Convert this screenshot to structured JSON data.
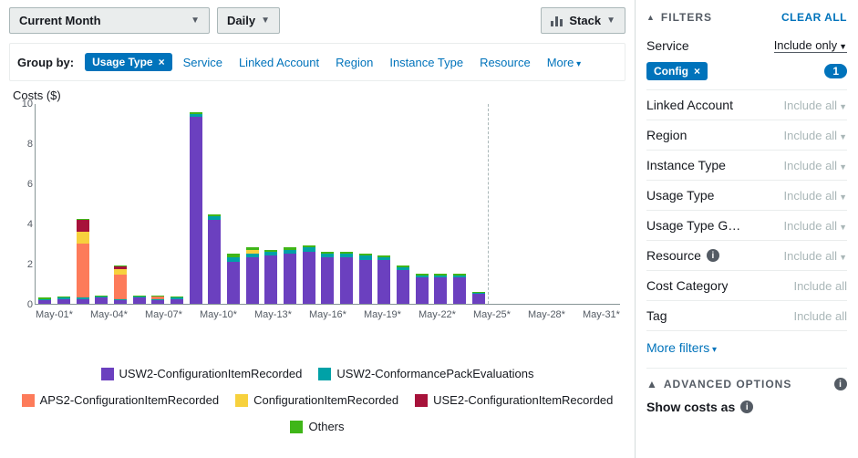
{
  "toolbar": {
    "range": "Current Month",
    "granularity": "Daily",
    "chart_mode": "Stack"
  },
  "groupby": {
    "label": "Group by:",
    "active": "Usage Type",
    "options": [
      "Service",
      "Linked Account",
      "Region",
      "Instance Type",
      "Resource",
      "More"
    ]
  },
  "chart_meta": {
    "ylabel": "Costs ($)"
  },
  "legend": {
    "items": [
      {
        "name": "USW2-ConfigurationItemRecorded",
        "color": "#6b40bf"
      },
      {
        "name": "USW2-ConformancePackEvaluations",
        "color": "#00a1a7"
      },
      {
        "name": "APS2-ConfigurationItemRecorded",
        "color": "#fd7b5a"
      },
      {
        "name": "ConfigurationItemRecorded",
        "color": "#f7d13d"
      },
      {
        "name": "USE2-ConfigurationItemRecorded",
        "color": "#a7123a"
      },
      {
        "name": "Others",
        "color": "#3fb618"
      }
    ]
  },
  "sidebar": {
    "filters_title": "FILTERS",
    "clear_all": "CLEAR ALL",
    "service": {
      "label": "Service",
      "mode": "Include only",
      "chip": "Config",
      "count": "1"
    },
    "rows": [
      {
        "label": "Linked Account",
        "value": "Include all",
        "dd": true
      },
      {
        "label": "Region",
        "value": "Include all",
        "dd": true
      },
      {
        "label": "Instance Type",
        "value": "Include all",
        "dd": true
      },
      {
        "label": "Usage Type",
        "value": "Include all",
        "dd": true
      },
      {
        "label": "Usage Type G…",
        "value": "Include all",
        "dd": true
      },
      {
        "label": "Resource",
        "value": "Include all",
        "dd": true,
        "info": true
      },
      {
        "label": "Cost Category",
        "value": "Include all",
        "dd": false
      },
      {
        "label": "Tag",
        "value": "Include all",
        "dd": false
      }
    ],
    "more_filters": "More filters",
    "advanced": "ADVANCED OPTIONS",
    "show_costs": "Show costs as"
  },
  "chart_data": {
    "type": "bar",
    "title": "Costs ($)",
    "xlabel": "",
    "ylabel": "Costs ($)",
    "ylim": [
      0,
      10
    ],
    "yticks": [
      0,
      2,
      4,
      6,
      8,
      10
    ],
    "categories": [
      "May-01*",
      "May-02*",
      "May-03*",
      "May-04*",
      "May-05*",
      "May-06*",
      "May-07*",
      "May-08*",
      "May-09*",
      "May-10*",
      "May-11*",
      "May-12*",
      "May-13*",
      "May-14*",
      "May-15*",
      "May-16*",
      "May-17*",
      "May-18*",
      "May-19*",
      "May-20*",
      "May-21*",
      "May-22*",
      "May-23*",
      "May-24*",
      "May-25*",
      "May-26*",
      "May-27*",
      "May-28*",
      "May-29*",
      "May-30*",
      "May-31*"
    ],
    "x_tick_labels": [
      "May-01*",
      "May-04*",
      "May-07*",
      "May-10*",
      "May-13*",
      "May-16*",
      "May-19*",
      "May-22*",
      "May-25*",
      "May-28*",
      "May-31*"
    ],
    "series": [
      {
        "name": "USW2-ConfigurationItemRecorded",
        "color": "#6b40bf",
        "values": [
          0.2,
          0.25,
          0.25,
          0.3,
          0.2,
          0.3,
          0.2,
          0.25,
          9.3,
          4.2,
          2.1,
          2.3,
          2.4,
          2.5,
          2.6,
          2.3,
          2.3,
          2.2,
          2.2,
          1.7,
          1.3,
          1.3,
          1.3,
          0.5,
          0,
          0,
          0,
          0,
          0,
          0,
          0
        ]
      },
      {
        "name": "USW2-ConformancePackEvaluations",
        "color": "#00a1a7",
        "values": [
          0.05,
          0.05,
          0.05,
          0.05,
          0.05,
          0.05,
          0.05,
          0.05,
          0.15,
          0.15,
          0.2,
          0.2,
          0.2,
          0.2,
          0.2,
          0.2,
          0.2,
          0.2,
          0.1,
          0.1,
          0.1,
          0.1,
          0.1,
          0.05,
          0,
          0,
          0,
          0,
          0,
          0,
          0
        ]
      },
      {
        "name": "APS2-ConfigurationItemRecorded",
        "color": "#fd7b5a",
        "values": [
          0,
          0,
          2.7,
          0,
          1.2,
          0,
          0.1,
          0,
          0,
          0,
          0,
          0,
          0,
          0,
          0,
          0,
          0,
          0,
          0,
          0,
          0,
          0,
          0,
          0,
          0,
          0,
          0,
          0,
          0,
          0,
          0
        ]
      },
      {
        "name": "ConfigurationItemRecorded",
        "color": "#f7d13d",
        "values": [
          0,
          0,
          0.6,
          0,
          0.3,
          0,
          0,
          0,
          0,
          0,
          0,
          0.2,
          0,
          0,
          0,
          0,
          0,
          0,
          0,
          0,
          0,
          0,
          0,
          0,
          0,
          0,
          0,
          0,
          0,
          0,
          0
        ]
      },
      {
        "name": "USE2-ConfigurationItemRecorded",
        "color": "#a7123a",
        "values": [
          0,
          0,
          0.6,
          0,
          0.1,
          0,
          0,
          0,
          0,
          0,
          0,
          0,
          0,
          0,
          0,
          0,
          0,
          0,
          0,
          0,
          0,
          0,
          0,
          0,
          0,
          0,
          0,
          0,
          0,
          0,
          0
        ]
      },
      {
        "name": "Others",
        "color": "#3fb618",
        "values": [
          0.05,
          0.05,
          0.05,
          0.05,
          0.05,
          0.05,
          0.05,
          0.05,
          0.1,
          0.1,
          0.2,
          0.1,
          0.1,
          0.1,
          0.1,
          0.1,
          0.1,
          0.1,
          0.1,
          0.1,
          0.1,
          0.1,
          0.1,
          0.05,
          0,
          0,
          0,
          0,
          0,
          0,
          0
        ]
      }
    ],
    "forecast_divider_index": 24
  }
}
